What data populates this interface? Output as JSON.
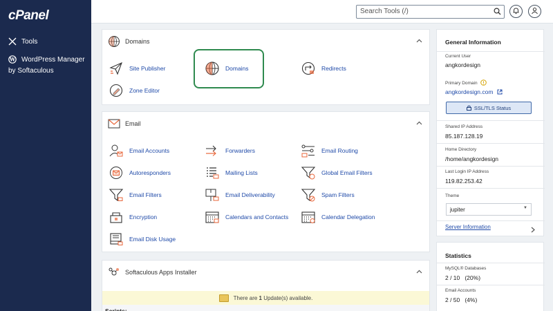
{
  "sidebar": {
    "logo": "cPanel",
    "items": [
      {
        "label": "Tools",
        "icon": "tools-icon"
      },
      {
        "label": "WordPress Manager",
        "icon": "wordpress-icon"
      }
    ],
    "wordpress_sub": "by Softaculous"
  },
  "topbar": {
    "search_placeholder": "Search Tools (/)"
  },
  "domains_panel": {
    "title": "Domains",
    "tools": [
      {
        "label": "Site Publisher",
        "icon": "paper-plane-icon"
      },
      {
        "label": "Domains",
        "icon": "globe-icon"
      },
      {
        "label": "Redirects",
        "icon": "redirect-icon"
      },
      {
        "label": "Zone Editor",
        "icon": "zone-editor-icon"
      }
    ]
  },
  "email_panel": {
    "title": "Email",
    "tools": [
      {
        "label": "Email Accounts",
        "icon": "email-accounts-icon"
      },
      {
        "label": "Forwarders",
        "icon": "forwarders-icon"
      },
      {
        "label": "Email Routing",
        "icon": "email-routing-icon"
      },
      {
        "label": "Autoresponders",
        "icon": "autoresponders-icon"
      },
      {
        "label": "Mailing Lists",
        "icon": "mailing-lists-icon"
      },
      {
        "label": "Global Email Filters",
        "icon": "global-filters-icon"
      },
      {
        "label": "Email Filters",
        "icon": "email-filters-icon"
      },
      {
        "label": "Email Deliverability",
        "icon": "deliverability-icon"
      },
      {
        "label": "Spam Filters",
        "icon": "spam-filters-icon"
      },
      {
        "label": "Encryption",
        "icon": "encryption-icon"
      },
      {
        "label": "Calendars and Contacts",
        "icon": "calendar-icon"
      },
      {
        "label": "Calendar Delegation",
        "icon": "calendar-delegation-icon"
      },
      {
        "label": "Email Disk Usage",
        "icon": "disk-usage-icon"
      }
    ]
  },
  "softaculous_panel": {
    "title": "Softaculous Apps Installer",
    "notice_pre": "There are ",
    "notice_count": "1",
    "notice_post": " Update(s) available.",
    "scripts_label": "Scripts:"
  },
  "general_info": {
    "title": "General Information",
    "current_user_label": "Current User",
    "current_user": "angkordesign",
    "primary_domain_label": "Primary Domain",
    "primary_domain": "angkordesign.com",
    "ssl_button": "SSL/TLS Status",
    "shared_ip_label": "Shared IP Address",
    "shared_ip": "85.187.128.19",
    "home_dir_label": "Home Directory",
    "home_dir": "/home/angkordesign",
    "last_login_label": "Last Login IP Address",
    "last_login": "119.82.253.42",
    "theme_label": "Theme",
    "theme_value": "jupiter",
    "server_info_link": "Server Information"
  },
  "statistics": {
    "title": "Statistics",
    "mysql_label": "MySQL® Databases",
    "mysql_value": "2 / 10   (20%)",
    "email_accounts_label": "Email Accounts",
    "email_accounts_value": "2 / 50   (4%)"
  },
  "colors": {
    "sidebar_bg": "#1b2a4e",
    "link": "#1f4aa8",
    "highlight": "#2e8a4e",
    "accent_orange": "#e8663a"
  }
}
